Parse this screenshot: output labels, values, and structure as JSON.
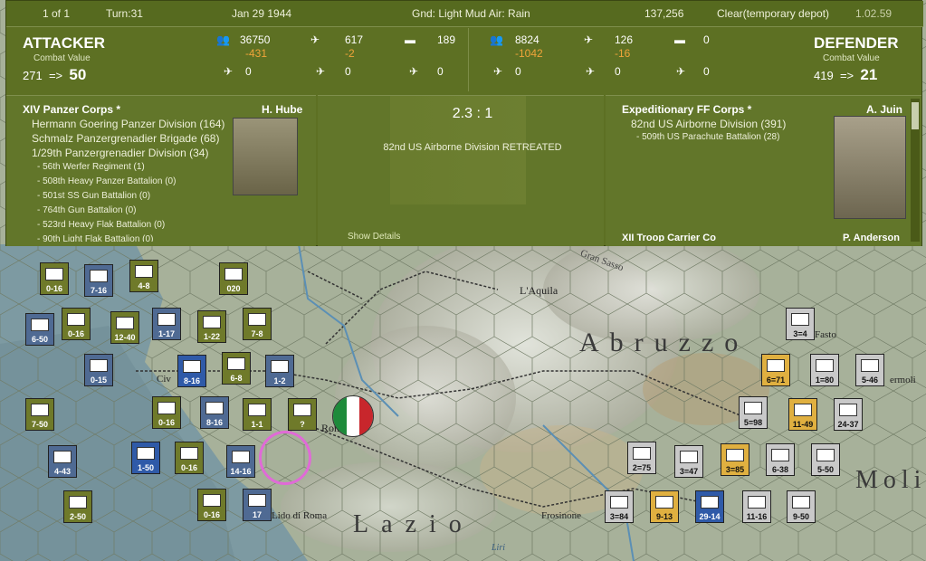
{
  "topbar": {
    "page": "1 of 1",
    "turn": "Turn:31",
    "date": "Jan 29 1944",
    "weather": "Gnd: Light Mud  Air: Rain",
    "supply": "137,256",
    "depot": "Clear(temporary depot)",
    "version": "1.02.59"
  },
  "attacker": {
    "title": "ATTACKER",
    "cv_label": "Combat Value",
    "cv_before": "271",
    "arrow": "=>",
    "cv_after": "50",
    "men": "36750",
    "men_loss": "-431",
    "guns": "617",
    "guns_loss": "-2",
    "tanks": "189",
    "air1": "0",
    "air2": "0",
    "air3": "0",
    "corps": "XIV Panzer Corps *",
    "leader": "H. Hube",
    "units": [
      "Hermann Goering Panzer Division (164)",
      "Schmalz Panzergrenadier Brigade (68)",
      "1/29th Panzergrenadier Division (34)"
    ],
    "subunits": [
      "- 56th Werfer Regiment (1)",
      "- 508th Heavy Panzer Battalion (0)",
      "- 501st SS Gun Battalion (0)",
      "- 764th Gun Battalion (0)",
      "- 523rd Heavy Flak Battalion (0)",
      "- 90th Light Flak Battalion (0)"
    ]
  },
  "defender": {
    "title": "DEFENDER",
    "cv_label": "Combat Value",
    "cv_before": "419",
    "arrow": "=>",
    "cv_after": "21",
    "men": "8824",
    "men_loss": "-1042",
    "guns": "126",
    "guns_loss": "-16",
    "tanks": "0",
    "air1": "0",
    "air2": "0",
    "air3": "0",
    "corps": "Expeditionary FF Corps *",
    "leader": "A. Juin",
    "units": [
      "82nd US Airborne Division (391)"
    ],
    "subunits": [
      "- 509th US Parachute Battalion (28)"
    ],
    "corps2": "XII Troop Carrier Co",
    "leader2": "P. Anderson"
  },
  "combat": {
    "ratio": "2.3 : 1",
    "result": "82nd US Airborne Division RETREATED",
    "show_details": "Show Details"
  },
  "map": {
    "places": [
      "L'Aquila",
      "Abruzzo",
      "Lazio",
      "Rome",
      "Civ",
      "Lido di Roma",
      "Frosinone",
      "Fasto",
      "ermoli",
      "Moli",
      "Liri",
      "Gran Sasso"
    ],
    "units": [
      {
        "lbl": "0-16"
      },
      {
        "lbl": "7-16"
      },
      {
        "lbl": "4-8"
      },
      {
        "lbl": "020"
      },
      {
        "lbl": "6-50"
      },
      {
        "lbl": "0-16"
      },
      {
        "lbl": "12-40"
      },
      {
        "lbl": "1-17"
      },
      {
        "lbl": "1-22"
      },
      {
        "lbl": "7-8"
      },
      {
        "lbl": "0-15"
      },
      {
        "lbl": "8-16"
      },
      {
        "lbl": "6-8"
      },
      {
        "lbl": "1-2"
      },
      {
        "lbl": "7-50"
      },
      {
        "lbl": "0-16"
      },
      {
        "lbl": "8-16"
      },
      {
        "lbl": "1-1"
      },
      {
        "lbl": "?"
      },
      {
        "lbl": "4-43"
      },
      {
        "lbl": "1-50"
      },
      {
        "lbl": "0-16"
      },
      {
        "lbl": "14-16"
      },
      {
        "lbl": "2-50"
      },
      {
        "lbl": "0-16"
      },
      {
        "lbl": "17"
      },
      {
        "lbl": "3=4"
      },
      {
        "lbl": "6=71"
      },
      {
        "lbl": "1=80"
      },
      {
        "lbl": "5-46"
      },
      {
        "lbl": "5=98"
      },
      {
        "lbl": "11-49"
      },
      {
        "lbl": "24-37"
      },
      {
        "lbl": "2=75"
      },
      {
        "lbl": "3=47"
      },
      {
        "lbl": "3=85"
      },
      {
        "lbl": "6-38"
      },
      {
        "lbl": "5-50"
      },
      {
        "lbl": "3=84"
      },
      {
        "lbl": "9-13"
      },
      {
        "lbl": "29-14"
      },
      {
        "lbl": "11-16"
      },
      {
        "lbl": "9-50"
      }
    ]
  },
  "colors": {
    "panel": "#5d7023",
    "loss": "#f0a43a",
    "german": "#6f7a2a",
    "allied_us": "#c9c9c9",
    "french": "#2f5aa8"
  }
}
